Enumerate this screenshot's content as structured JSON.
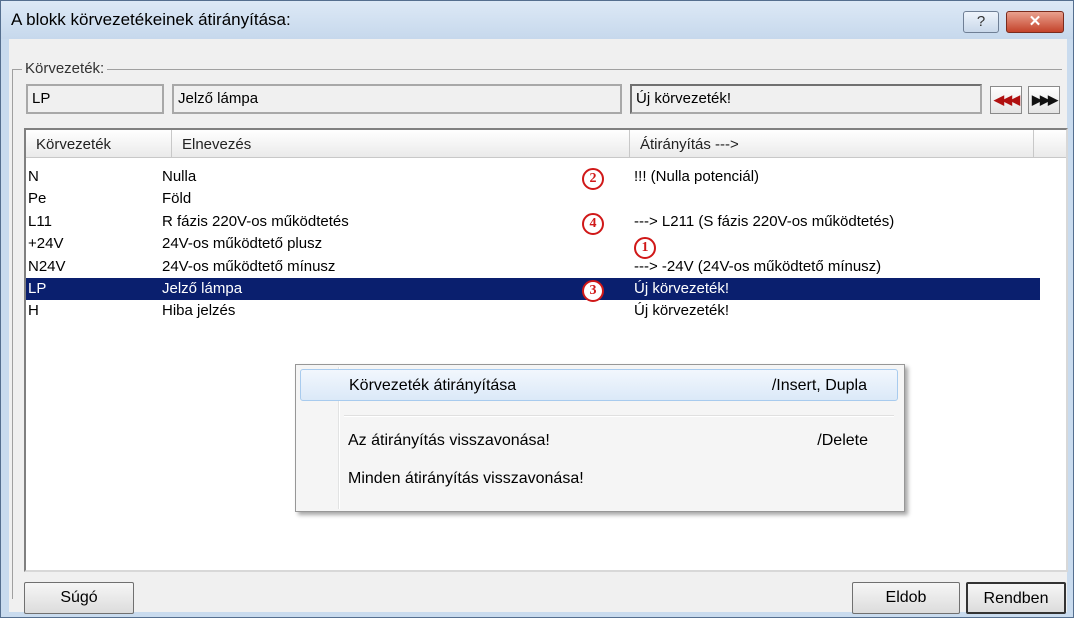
{
  "window": {
    "title": "A blokk körvezetékeinek átirányítása:",
    "help_glyph": "?",
    "close_glyph": "✕"
  },
  "group": {
    "label": "Körvezeték:"
  },
  "current": {
    "code": "LP",
    "name": "Jelző lámpa",
    "target": "Új körvezeték!"
  },
  "nav": {
    "prev_glyph": "◀◀◀",
    "next_glyph": "▶▶▶"
  },
  "columns": [
    "Körvezeték",
    "Elnevezés",
    "Átirányítás --->",
    ""
  ],
  "rows": [
    {
      "code": "N",
      "name": "Nulla",
      "target": "!!! (Nulla potenciál)",
      "marker": "2",
      "selected": false
    },
    {
      "code": "Pe",
      "name": "Föld",
      "target": "",
      "marker": "",
      "selected": false
    },
    {
      "code": "L11",
      "name": "R fázis 220V-os működtetés",
      "target": "---> L211  (S fázis 220V-os működtetés)",
      "marker": "4",
      "selected": false
    },
    {
      "code": "+24V",
      "name": "24V-os működtető plusz",
      "target": "",
      "marker": "1",
      "selected": false
    },
    {
      "code": "N24V",
      "name": "24V-os működtető mínusz",
      "target": "---> -24V  (24V-os működtető mínusz)",
      "marker": "",
      "selected": false
    },
    {
      "code": "LP",
      "name": "Jelző lámpa",
      "target": "Új körvezeték!",
      "marker": "3",
      "selected": true
    },
    {
      "code": "H",
      "name": "Hiba jelzés",
      "target": "Új körvezeték!",
      "marker": "",
      "selected": false
    }
  ],
  "context_menu": {
    "items": [
      {
        "label": "Körvezeték átirányítása",
        "shortcut": "/Insert, Dupla"
      },
      {
        "label": "Az átirányítás visszavonása!",
        "shortcut": "/Delete"
      },
      {
        "label": "Minden átirányítás visszavonása!",
        "shortcut": ""
      }
    ]
  },
  "buttons": {
    "help": "Súgó",
    "cancel": "Eldob",
    "ok": "Rendben"
  },
  "colors": {
    "selection": "#0a1f6e",
    "marker": "#d01818"
  }
}
